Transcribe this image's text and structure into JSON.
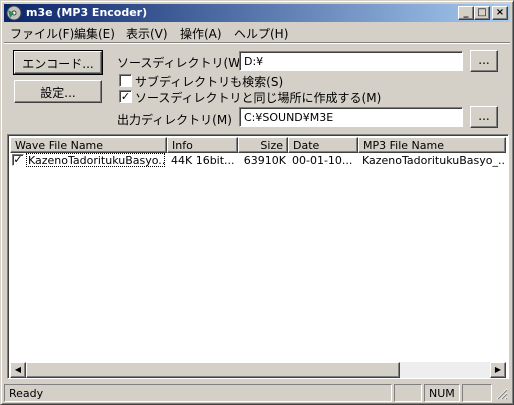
{
  "window": {
    "title": "m3e (MP3 Encoder)",
    "min_label": "_",
    "max_label": "□",
    "close_label": "×"
  },
  "menu": [
    "ファイル(F)",
    "編集(E)",
    "表示(V)",
    "操作(A)",
    "ヘルプ(H)"
  ],
  "buttons": {
    "encode": "エンコード...",
    "settings": "設定...",
    "browse_source": "...",
    "browse_output": "..."
  },
  "source": {
    "label": "ソースディレクトリ(W):",
    "value": "D:¥"
  },
  "options": {
    "subdir_label": "サブディレクトリも検索(S)",
    "subdir_checked": false,
    "same_place_label": "ソースディレクトリと同じ場所に作成する(M)",
    "same_place_checked": true,
    "check_mark": "✓"
  },
  "output": {
    "label": "出力ディレクトリ(M)",
    "value": "C:¥SOUND¥M3E"
  },
  "list": {
    "columns": [
      "Wave File Name",
      "Info",
      "Size",
      "Date",
      "MP3 File Name"
    ],
    "rows": [
      {
        "checked": true,
        "wave": "KazenoTadoritukuBasyo...",
        "info": "44K 16bit...",
        "size": "63910K",
        "date": "00-01-10...",
        "mp3": "KazenoTadoritukuBasyo_..."
      }
    ]
  },
  "scrollbar": {
    "left_arrow": "◀",
    "right_arrow": "▶"
  },
  "status": {
    "text": "Ready",
    "num": "NUM"
  }
}
